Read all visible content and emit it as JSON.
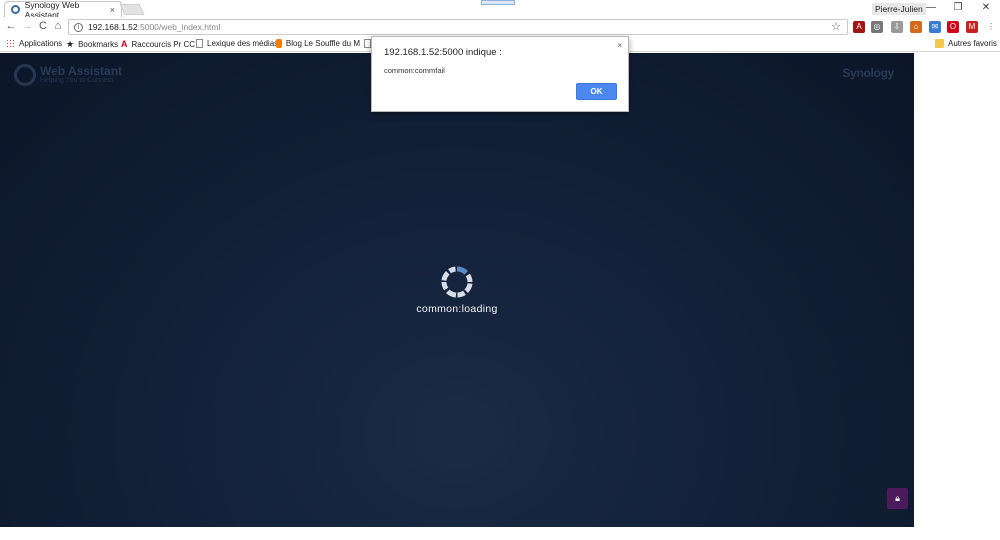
{
  "tab": {
    "title": "Synology Web Assistant",
    "close": "×"
  },
  "window": {
    "profile": "Pierre-Julien",
    "minimize": "—",
    "restore": "❐",
    "close": "✕"
  },
  "toolbar": {
    "back": "←",
    "forward": "→",
    "reload": "C",
    "home": "⌂",
    "url_host": "192.168.1.52",
    "url_path": ":5000/web_index.html",
    "bookmark_star": "☆",
    "extensions": [
      {
        "icon": "pdf-icon",
        "color": "#a01515",
        "glyph": "A"
      },
      {
        "icon": "chrome-icon",
        "color": "#777777",
        "glyph": "◎"
      },
      {
        "icon": "download-icon",
        "color": "#999999",
        "glyph": "⇩"
      },
      {
        "icon": "home-ext-icon",
        "color": "#d36b1a",
        "glyph": "⌂"
      },
      {
        "icon": "extension-badge-icon",
        "color": "#3a7bd5",
        "glyph": "✉"
      },
      {
        "icon": "opera-icon",
        "color": "#d0021b",
        "glyph": "O"
      },
      {
        "icon": "gmail-icon",
        "color": "#c5221f",
        "glyph": "M"
      },
      {
        "icon": "menu-icon",
        "color": "#555555",
        "glyph": "⋮"
      }
    ]
  },
  "bookmarks": {
    "items": [
      {
        "label": "Applications",
        "icon": "apps-grid-icon"
      },
      {
        "label": "Bookmarks",
        "icon": "star-icon"
      },
      {
        "label": "Raccourcis Pr CC",
        "icon": "adobe-icon"
      },
      {
        "label": "Lexique des médias",
        "icon": "page-icon"
      },
      {
        "label": "Blog Le Souffle du M",
        "icon": "blogger-icon"
      }
    ],
    "other": "Autres favoris"
  },
  "page": {
    "app_title": "Web Assistant",
    "app_subtitle": "Helping You to Connect",
    "brand": "Synology",
    "loading": "common:loading"
  },
  "dialog": {
    "title": "192.168.1.52:5000 indique :",
    "message": "common:commfail",
    "ok": "OK",
    "close": "×"
  },
  "colors": {
    "page_bg": "#13213a",
    "accent": "#4a88f0",
    "lock_bg": "#4b1b5c"
  }
}
